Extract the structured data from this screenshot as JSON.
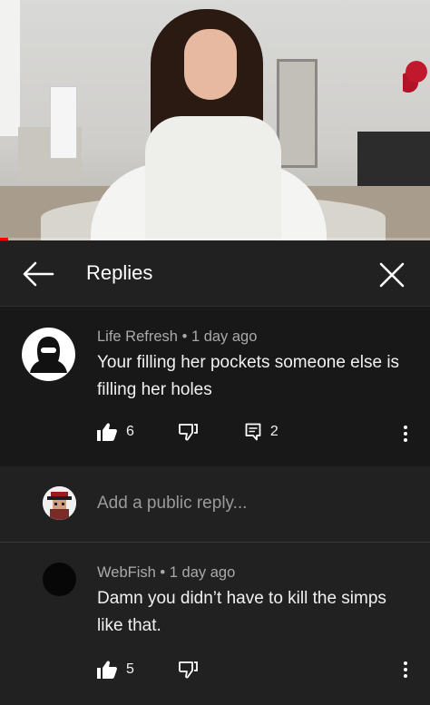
{
  "video": {
    "progress_fraction": 0.02,
    "progress_color": "#ff0000"
  },
  "header": {
    "title": "Replies"
  },
  "comment": {
    "author": "Life Refresh",
    "separator": "•",
    "time": "1 day ago",
    "text": "Your filling her pockets someone else is filling her holes",
    "likes": "6",
    "replies": "2"
  },
  "reply_box": {
    "placeholder": "Add a public reply..."
  },
  "reply": {
    "author": "WebFish",
    "separator": "•",
    "time": "1 day ago",
    "text": "Damn you didn’t have to kill the simps like that.",
    "likes": "5"
  },
  "icons": {
    "back": "arrow-left-icon",
    "close": "close-icon",
    "like": "thumbs-up-icon",
    "dislike": "thumbs-down-icon",
    "reply": "reply-comment-icon",
    "more": "more-vert-icon"
  }
}
